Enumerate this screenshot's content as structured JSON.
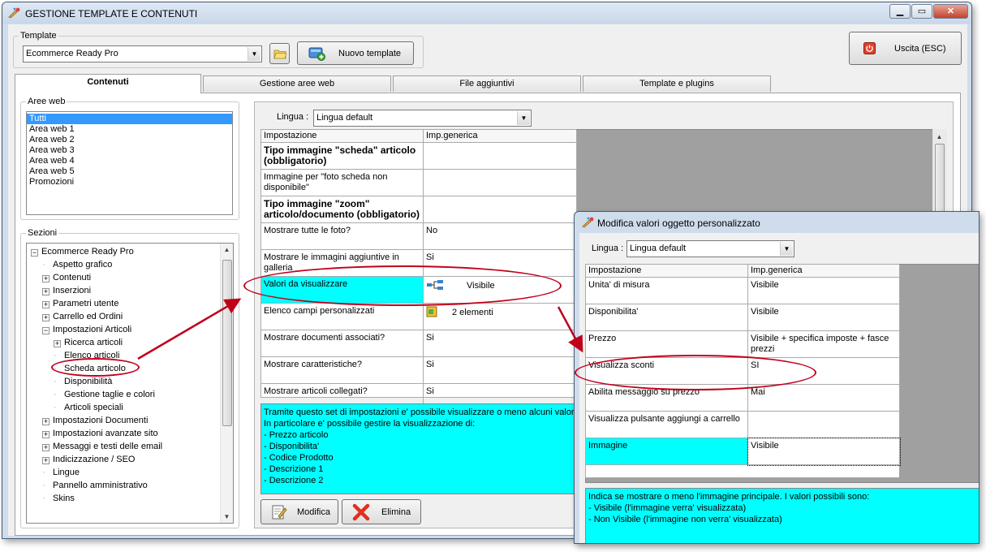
{
  "window": {
    "title": "GESTIONE TEMPLATE E CONTENUTI",
    "min": "▁",
    "max": "▭",
    "close": "✕"
  },
  "template_group": {
    "legend": "Template",
    "selected": "Ecommerce Ready Pro",
    "new_button": "Nuovo template"
  },
  "exit_button": "Uscita (ESC)",
  "tabs": [
    {
      "label": "Contenuti",
      "active": true
    },
    {
      "label": "Gestione aree web"
    },
    {
      "label": "File aggiuntivi"
    },
    {
      "label": "Template e plugins"
    }
  ],
  "aree_web": {
    "legend": "Aree web",
    "items": [
      "Tutti",
      "Area web 1",
      "Area web 2",
      "Area web 3",
      "Area web 4",
      "Area web 5",
      "Promozioni"
    ]
  },
  "sezioni": {
    "legend": "Sezioni",
    "items": [
      {
        "label": "Ecommerce Ready Pro",
        "sign": "−"
      },
      {
        "label": "Aspetto grafico",
        "sign": ""
      },
      {
        "label": "Contenuti",
        "sign": "+"
      },
      {
        "label": "Inserzioni",
        "sign": "+"
      },
      {
        "label": "Parametri utente",
        "sign": "+"
      },
      {
        "label": "Carrello ed Ordini",
        "sign": "+"
      },
      {
        "label": "Impostazioni Articoli",
        "sign": "−"
      },
      {
        "label": "Ricerca articoli",
        "sign": "+"
      },
      {
        "label": "Elenco articoli",
        "sign": ""
      },
      {
        "label": "Scheda articolo",
        "sign": ""
      },
      {
        "label": "Disponibilità",
        "sign": ""
      },
      {
        "label": "Gestione taglie e colori",
        "sign": ""
      },
      {
        "label": "Articoli speciali",
        "sign": ""
      },
      {
        "label": "Impostazioni Documenti",
        "sign": "+"
      },
      {
        "label": "Impostazioni avanzate sito",
        "sign": "+"
      },
      {
        "label": "Messaggi e testi delle email",
        "sign": "+"
      },
      {
        "label": "Indicizzazione / SEO",
        "sign": "+"
      },
      {
        "label": "Lingue",
        "sign": ""
      },
      {
        "label": "Pannello amministrativo",
        "sign": ""
      },
      {
        "label": "Skins",
        "sign": ""
      }
    ]
  },
  "main": {
    "lingua_label": "Lingua :",
    "lingua_value": "Lingua default",
    "headers": [
      "Impostazione",
      "Imp.generica"
    ],
    "rows": [
      {
        "name": "Tipo immagine \"scheda\" articolo (obbligatorio)",
        "value": "",
        "bold": true
      },
      {
        "name": "Immagine per \"foto scheda non disponibile\"",
        "value": ""
      },
      {
        "name": "Tipo immagine \"zoom\" articolo/documento (obbligatorio)",
        "value": "",
        "bold": true
      },
      {
        "name": "Mostrare tutte le foto?",
        "value": "No"
      },
      {
        "name": "Mostrare le immagini aggiuntive in galleria",
        "value": "Si"
      },
      {
        "name": "Valori da visualizzare",
        "value": "Visibile",
        "selected": true
      },
      {
        "name": "Elenco campi personalizzati",
        "value": "2 elementi"
      },
      {
        "name": "Mostrare documenti associati?",
        "value": "Si"
      },
      {
        "name": "Mostrare caratteristiche?",
        "value": "Si"
      },
      {
        "name": "Mostrare articoli collegati?",
        "value": "Si"
      }
    ],
    "description": "Tramite questo set di impostazioni e' possibile visualizzare o meno alcuni valori ne\nIn particolare e' possibile gestire la visualizzazione di:\n- Prezzo articolo\n- Disponibilita'\n- Codice Prodotto\n- Descrizione 1\n- Descrizione 2",
    "modifica_button": "Modifica",
    "elimina_button": "Elimina"
  },
  "popup": {
    "title": "Modifica valori oggetto personalizzato",
    "lingua_label": "Lingua :",
    "lingua_value": "Lingua default",
    "headers": [
      "Impostazione",
      "Imp.generica"
    ],
    "rows": [
      {
        "name": "Unita' di misura",
        "value": "Visibile"
      },
      {
        "name": "Disponibilita'",
        "value": "Visibile"
      },
      {
        "name": "Prezzo",
        "value": "Visibile + specifica imposte + fasce prezzi"
      },
      {
        "name": "Visualizza sconti",
        "value": "SI"
      },
      {
        "name": "Abilita messaggio su prezzo",
        "value": "Mai"
      },
      {
        "name": "Visualizza pulsante aggiungi a carrello",
        "value": ""
      },
      {
        "name": "Immagine",
        "value": "Visibile",
        "selected": true
      }
    ],
    "description": "Indica se mostrare o meno l'immagine principale. I valori possibili sono:\n- Visibile (l'immagine verra' visualizzata)\n- Non Visibile (l'immagine non verra' visualizzata)"
  },
  "colors": {
    "selection": "#00ffff",
    "highlight": "#c0001a",
    "list_selection": "#3399ff"
  }
}
